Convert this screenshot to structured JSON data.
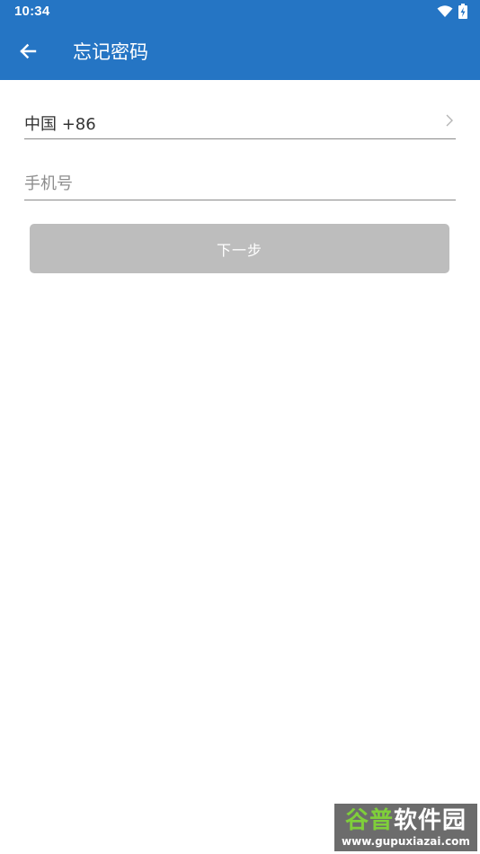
{
  "status_bar": {
    "time": "10:34",
    "icons": [
      "wifi-icon",
      "battery-charging-icon"
    ]
  },
  "app_bar": {
    "back_icon": "arrow-left-icon",
    "title": "忘记密码",
    "background_color": "#2575c4"
  },
  "form": {
    "country": {
      "value": "中国 +86",
      "icon": "chevron-right-icon"
    },
    "phone": {
      "value": "",
      "placeholder": "手机号"
    },
    "next_button": {
      "label": "下一步",
      "disabled_color": "#bdbdbd"
    }
  },
  "watermark": {
    "title_part1": "谷普",
    "title_part2": "软件园",
    "url": "www.gupuxiazai.com"
  }
}
